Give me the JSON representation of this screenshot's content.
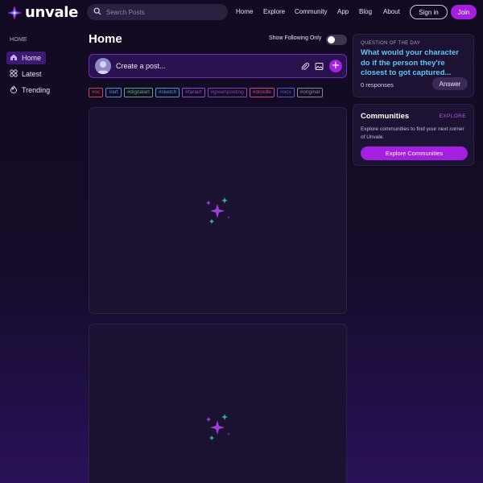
{
  "brand": {
    "name": "unvale",
    "accent": "#a51fe0"
  },
  "search": {
    "placeholder": "Search Posts"
  },
  "nav": [
    "Home",
    "Explore",
    "Community",
    "App",
    "Blog",
    "About"
  ],
  "auth": {
    "signin": "Sign in",
    "join": "Join"
  },
  "sidebar": {
    "section_title": "HOME",
    "items": [
      {
        "label": "Home",
        "icon": "home-icon",
        "active": true
      },
      {
        "label": "Latest",
        "icon": "grid-icon",
        "active": false
      },
      {
        "label": "Trending",
        "icon": "flame-icon",
        "active": false
      }
    ]
  },
  "main": {
    "title": "Home",
    "follow_toggle": {
      "label": "Show Following Only",
      "on": false
    },
    "composer": {
      "placeholder": "Create a post...",
      "icons": [
        "paperclip-icon",
        "image-icon",
        "plus-icon"
      ]
    },
    "tags": [
      {
        "label": "#oc",
        "color": "#c9474f"
      },
      {
        "label": "#art",
        "color": "#4f8fd8"
      },
      {
        "label": "#digitalart",
        "color": "#5aa87a"
      },
      {
        "label": "#sketch",
        "color": "#3f9ad6"
      },
      {
        "label": "#fanart",
        "color": "#8a4fd0"
      },
      {
        "label": "#greenposting",
        "color": "#7a46b8"
      },
      {
        "label": "#doodle",
        "color": "#c6458f"
      },
      {
        "label": "#ocs",
        "color": "#5b56c9"
      },
      {
        "label": "#original",
        "color": "#8a8599"
      }
    ],
    "cards": [
      {
        "loading_icon": "sparkle-icon"
      },
      {
        "loading_icon": "sparkle-icon"
      }
    ]
  },
  "qotd": {
    "label": "QUESTION OF THE DAY",
    "question": "What would your character do if the person they're closest to got captured...",
    "responses": "0 responses",
    "answer_button": "Answer"
  },
  "communities": {
    "title": "Communities",
    "explore_link": "EXPLORE",
    "description": "Explore communities to find your next corner of Unvale.",
    "button": "Explore Communities"
  }
}
